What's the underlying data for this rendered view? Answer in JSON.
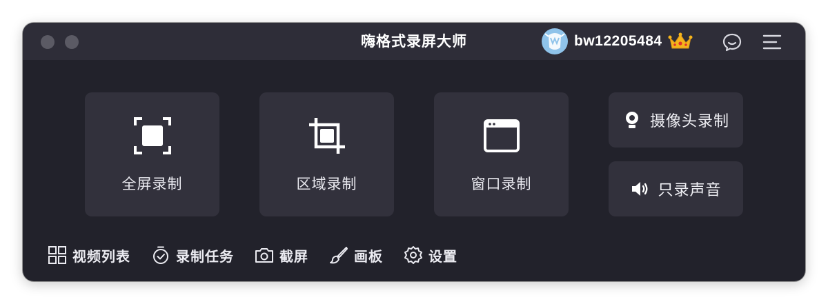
{
  "app": {
    "title": "嗨格式录屏大师"
  },
  "user": {
    "name": "bw12205484"
  },
  "modes": [
    {
      "label": "全屏录制",
      "icon": "fullscreen-icon"
    },
    {
      "label": "区域录制",
      "icon": "crop-icon"
    },
    {
      "label": "窗口录制",
      "icon": "window-icon"
    }
  ],
  "side_modes": [
    {
      "label": "摄像头录制",
      "icon": "webcam-icon"
    },
    {
      "label": "只录声音",
      "icon": "speaker-icon"
    }
  ],
  "bottom_nav": [
    {
      "label": "视频列表",
      "icon": "grid-icon"
    },
    {
      "label": "录制任务",
      "icon": "timer-icon"
    },
    {
      "label": "截屏",
      "icon": "camera-icon"
    },
    {
      "label": "画板",
      "icon": "brush-icon"
    },
    {
      "label": "设置",
      "icon": "settings-gear-icon"
    }
  ],
  "colors": {
    "window_bg": "#22222b",
    "titlebar_bg": "#2e2d38",
    "tile_bg": "#32313c",
    "text": "#ffffff",
    "crown": "#f5b41b"
  }
}
